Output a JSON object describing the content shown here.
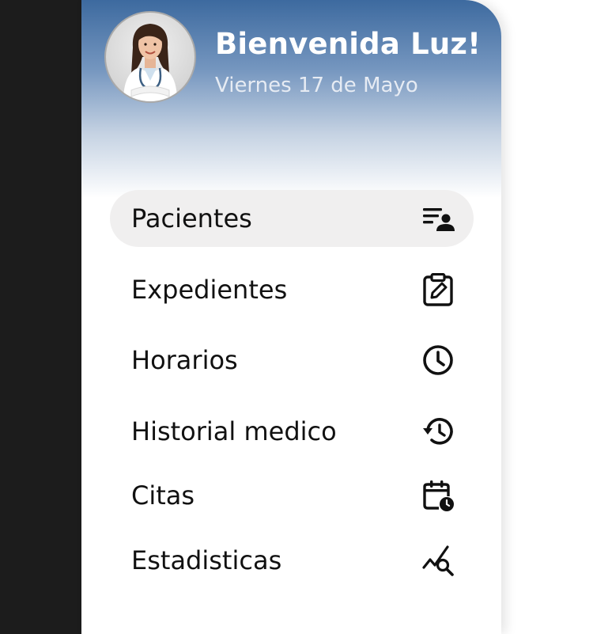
{
  "header": {
    "greeting": "Bienvenida Luz!",
    "date": "Viernes 17 de Mayo",
    "avatar_icon": "doctor-avatar"
  },
  "menu": {
    "items": [
      {
        "label": "Pacientes",
        "icon": "patient-list-icon",
        "active": true
      },
      {
        "label": "Expedientes",
        "icon": "clipboard-edit-icon",
        "active": false
      },
      {
        "label": "Horarios",
        "icon": "clock-icon",
        "active": false
      },
      {
        "label": "Historial medico",
        "icon": "history-icon",
        "active": false
      },
      {
        "label": "Citas",
        "icon": "calendar-clock-icon",
        "active": false
      },
      {
        "label": "Estadisticas",
        "icon": "stats-search-icon",
        "active": false
      }
    ]
  },
  "colors": {
    "header_top": "#3d6a9f",
    "active_item_bg": "#f0efef",
    "left_strip": "#1c1c1c",
    "text": "#111111"
  }
}
